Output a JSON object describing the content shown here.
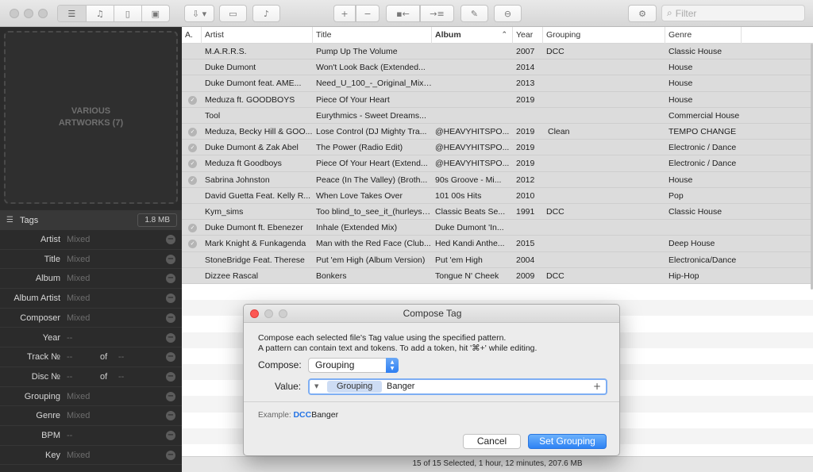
{
  "toolbar": {
    "filter_placeholder": "Filter",
    "icons": [
      "list-view-icon",
      "music-notes-icon",
      "document-icon",
      "artwork-icon",
      "import-icon",
      "folder-icon",
      "itunes-icon",
      "add-icon",
      "remove-icon",
      "move-left-icon",
      "move-right-icon",
      "edit-icon",
      "clear-icon",
      "settings-icon",
      "search-icon"
    ]
  },
  "sidebar": {
    "artwork_line1": "VARIOUS",
    "artwork_line2": "ARTWORKS (7)",
    "tags_label": "Tags",
    "size": "1.8 MB",
    "of_label": "of",
    "fields": [
      {
        "label": "Artist",
        "value": "Mixed"
      },
      {
        "label": "Title",
        "value": "Mixed"
      },
      {
        "label": "Album",
        "value": "Mixed"
      },
      {
        "label": "Album Artist",
        "value": "Mixed"
      },
      {
        "label": "Composer",
        "value": "Mixed"
      },
      {
        "label": "Year",
        "value": "--"
      },
      {
        "label": "Track №",
        "value": "--",
        "value2": "--"
      },
      {
        "label": "Disc №",
        "value": "--",
        "value2": "--"
      },
      {
        "label": "Grouping",
        "value": "Mixed"
      },
      {
        "label": "Genre",
        "value": "Mixed"
      },
      {
        "label": "BPM",
        "value": "--"
      },
      {
        "label": "Key",
        "value": "Mixed"
      }
    ]
  },
  "table": {
    "columns": [
      "A.",
      "Artist",
      "Title",
      "Album",
      "Year",
      "Grouping",
      "Genre"
    ],
    "rows": [
      {
        "check": false,
        "artist": "M.A.R.R.S.",
        "title": "Pump Up The Volume",
        "album": "",
        "year": "2007",
        "grouping": "DCC",
        "genre": "Classic House"
      },
      {
        "check": false,
        "artist": "Duke Dumont",
        "title": "Won't Look Back (Extended...",
        "album": "",
        "year": "2014",
        "grouping": "",
        "genre": "House"
      },
      {
        "check": false,
        "artist": "Duke Dumont feat. AME...",
        "title": "Need_U_100_-_Original_Mix_-...",
        "album": "",
        "year": "2013",
        "grouping": "",
        "genre": "House"
      },
      {
        "check": true,
        "artist": "Meduza ft. GOODBOYS",
        "title": "Piece Of Your Heart",
        "album": "",
        "year": "2019",
        "grouping": "",
        "genre": "House"
      },
      {
        "check": false,
        "artist": "Tool",
        "title": "Eurythmics - Sweet Dreams...",
        "album": "",
        "year": "",
        "grouping": "",
        "genre": "Commercial House"
      },
      {
        "check": true,
        "artist": "Meduza, Becky Hill & GOO...",
        "title": "Lose Control (DJ Mighty Tra...",
        "album": "@HEAVYHITSPO...",
        "year": "2019",
        "grouping": "Clean",
        "genre": "TEMPO CHANGE"
      },
      {
        "check": true,
        "artist": "Duke Dumont & Zak Abel",
        "title": "The Power (Radio Edit)",
        "album": "@HEAVYHITSPO...",
        "year": "2019",
        "grouping": "",
        "genre": "Electronic / Dance"
      },
      {
        "check": true,
        "artist": "Meduza ft Goodboys",
        "title": "Piece Of Your Heart (Extend...",
        "album": "@HEAVYHITSPO...",
        "year": "2019",
        "grouping": "",
        "genre": "Electronic / Dance"
      },
      {
        "check": true,
        "artist": "Sabrina Johnston",
        "title": "Peace (In The Valley) (Broth...",
        "album": "90s Groove - Mi...",
        "year": "2012",
        "grouping": "",
        "genre": "House"
      },
      {
        "check": false,
        "artist": "David Guetta Feat. Kelly R...",
        "title": "When Love Takes Over",
        "album": "101 00s Hits",
        "year": "2010",
        "grouping": "",
        "genre": "Pop"
      },
      {
        "check": false,
        "artist": "Kym_sims",
        "title": "Too blind_to_see_it_(hurleys_...",
        "album": "Classic Beats Se...",
        "year": "1991",
        "grouping": "DCC",
        "genre": "Classic House"
      },
      {
        "check": true,
        "artist": "Duke Dumont ft. Ebenezer",
        "title": "Inhale (Extended Mix)",
        "album": "Duke Dumont 'In...",
        "year": "",
        "grouping": "",
        "genre": ""
      },
      {
        "check": true,
        "artist": "Mark Knight & Funkagenda",
        "title": "Man with the Red Face (Club...",
        "album": "Hed Kandi Anthe...",
        "year": "2015",
        "grouping": "",
        "genre": "Deep House"
      },
      {
        "check": false,
        "artist": "StoneBridge Feat. Therese",
        "title": "Put 'em High (Album Version)",
        "album": "Put 'em High",
        "year": "2004",
        "grouping": "",
        "genre": "Electronica/Dance"
      },
      {
        "check": false,
        "artist": "Dizzee Rascal",
        "title": "Bonkers",
        "album": "Tongue N' Cheek",
        "year": "2009",
        "grouping": "DCC",
        "genre": "Hip-Hop"
      }
    ]
  },
  "status": "15 of 15 Selected, 1 hour, 12 minutes, 207.6 MB",
  "dialog": {
    "title": "Compose Tag",
    "info_line1": "Compose each selected file's Tag value using the specified pattern.",
    "info_line2": "A pattern can contain text and tokens. To add a token, hit '⌘+' while editing.",
    "compose_label": "Compose:",
    "compose_value": "Grouping",
    "value_label": "Value:",
    "token": "Grouping",
    "value_text": "Banger",
    "example_label": "Example:",
    "example_token": "DCC",
    "example_text": "Banger",
    "cancel_label": "Cancel",
    "confirm_label": "Set Grouping"
  },
  "colors": {
    "accent": "#2d82f4",
    "close": "#fc5753",
    "token_bg": "#cddcf4"
  }
}
